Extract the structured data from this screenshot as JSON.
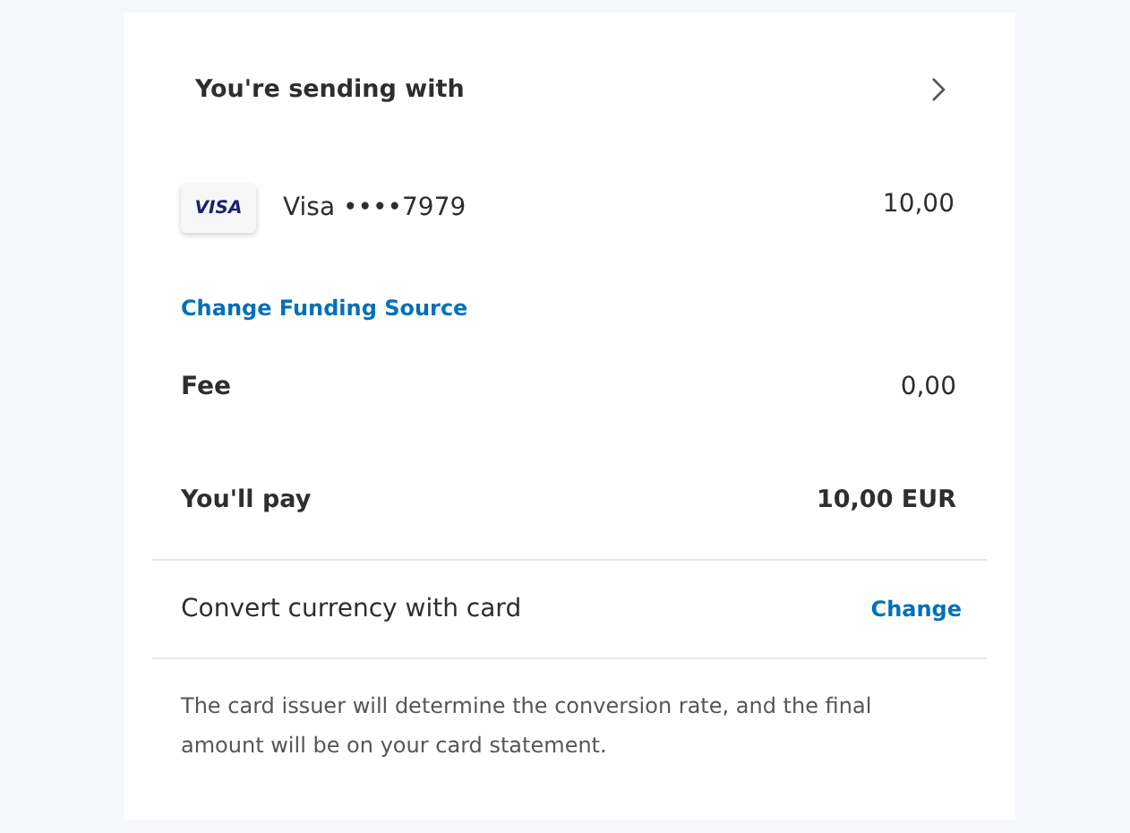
{
  "header": {
    "title": "You're sending with"
  },
  "funding": {
    "brand": "VISA",
    "name": "Visa ••••7979",
    "amount": "10,00"
  },
  "change_funding_link": "Change Funding Source",
  "fee": {
    "label": "Fee",
    "value": "0,00"
  },
  "total": {
    "label": "You'll pay",
    "value": "10,00 EUR"
  },
  "conversion": {
    "label": "Convert currency with card",
    "link": "Change"
  },
  "note": "The card issuer will determine the conversion rate, and the final amount will be on your card statement."
}
